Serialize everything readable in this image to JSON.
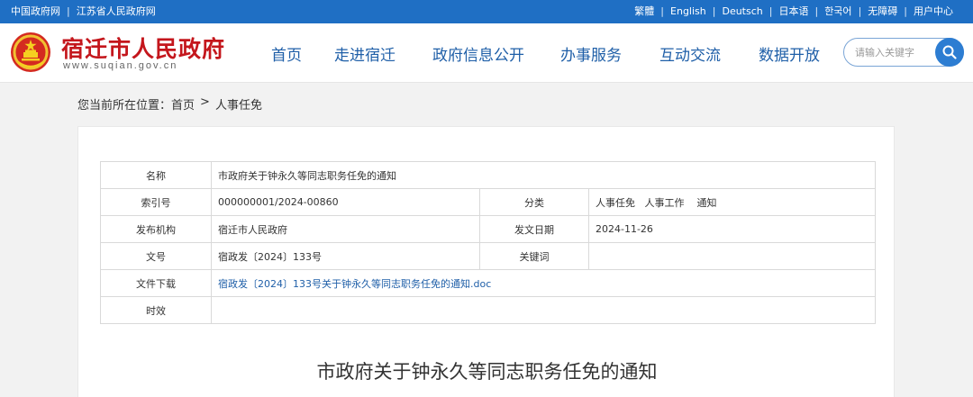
{
  "topbar": {
    "left_links": [
      "中国政府网",
      "江苏省人民政府网"
    ],
    "right_links": [
      "繁體",
      "English",
      "Deutsch",
      "日本语",
      "한국어",
      "无障碍",
      "用户中心"
    ],
    "separator": "|"
  },
  "header": {
    "site_name": "宿迁市人民政府",
    "site_url": "www.suqian.gov.cn"
  },
  "nav": {
    "items": [
      "首页",
      "走进宿迁",
      "政府信息公开",
      "办事服务",
      "互动交流",
      "数据开放"
    ]
  },
  "search": {
    "placeholder": "请输入关键字"
  },
  "breadcrumb": {
    "prefix": "您当前所在位置：",
    "items": [
      "首页",
      "人事任免"
    ],
    "separator": ">"
  },
  "meta_table": {
    "name_label": "名称",
    "name_value": "市政府关于钟永久等同志职务任免的通知",
    "index_label": "索引号",
    "index_value": "000000001/2024-00860",
    "category_label": "分类",
    "category_value": "人事任免   人事工作    通知",
    "issuer_label": "发布机构",
    "issuer_value": "宿迁市人民政府",
    "date_label": "发文日期",
    "date_value": "2024-11-26",
    "docno_label": "文号",
    "docno_value": "宿政发〔2024〕133号",
    "keywords_label": "关键词",
    "keywords_value": "",
    "download_label": "文件下载",
    "download_value": "宿政发〔2024〕133号关于钟永久等同志职务任免的通知.doc",
    "validity_label": "时效",
    "validity_value": ""
  },
  "document": {
    "title": "市政府关于钟永久等同志职务任免的通知"
  },
  "colors": {
    "topbar": "#1f6fc4",
    "brand_red": "#c4161c",
    "nav_blue": "#1f5fa8",
    "search_button": "#2d7dd2"
  }
}
